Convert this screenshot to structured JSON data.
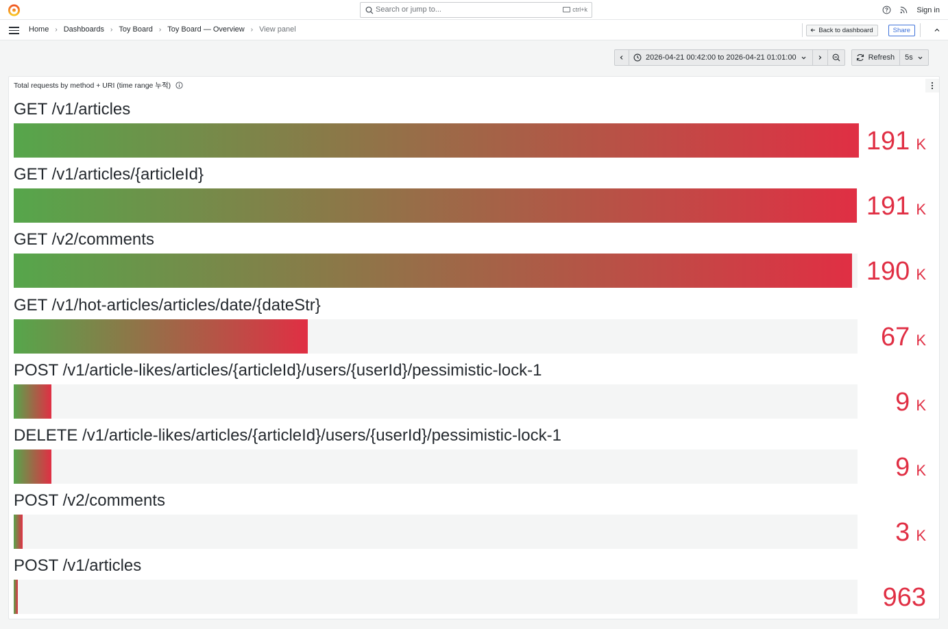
{
  "topbar": {
    "search_placeholder": "Search or jump to...",
    "search_shortcut": "ctrl+k",
    "signin_label": "Sign in"
  },
  "breadcrumb": [
    "Home",
    "Dashboards",
    "Toy Board",
    "Toy Board — Overview",
    "View panel"
  ],
  "navbar": {
    "back_label": "Back to dashboard",
    "share_label": "Share"
  },
  "time_controls": {
    "range_label": "2026-04-21 00:42:00 to 2026-04-21 01:01:00",
    "refresh_label": "Refresh",
    "refresh_interval": "5s"
  },
  "panel": {
    "title": "Total requests by method + URI (time range 누적)"
  },
  "colors": {
    "gradient_start": "#56a64b",
    "gradient_end": "#e02f44",
    "value_color": "#e02f44",
    "accent": "#3d71d9"
  },
  "chart_data": {
    "type": "bar",
    "orientation": "horizontal",
    "max": 191000,
    "rows": [
      {
        "label": "GET /v1/articles",
        "value": 191000,
        "display": "191",
        "unit": "K"
      },
      {
        "label": "GET /v1/articles/{articleId}",
        "value": 190500,
        "display": "191",
        "unit": "K"
      },
      {
        "label": "GET /v2/comments",
        "value": 189600,
        "display": "190",
        "unit": "K"
      },
      {
        "label": "GET /v1/hot-articles/articles/date/{dateStr}",
        "value": 66500,
        "display": "67",
        "unit": "K"
      },
      {
        "label": "POST /v1/article-likes/articles/{articleId}/users/{userId}/pessimistic-lock-1",
        "value": 8600,
        "display": "9",
        "unit": "K"
      },
      {
        "label": "DELETE /v1/article-likes/articles/{articleId}/users/{userId}/pessimistic-lock-1",
        "value": 8600,
        "display": "9",
        "unit": "K"
      },
      {
        "label": "POST /v2/comments",
        "value": 2000,
        "display": "3",
        "unit": "K"
      },
      {
        "label": "POST /v1/articles",
        "value": 963,
        "display": "963",
        "unit": ""
      }
    ]
  }
}
